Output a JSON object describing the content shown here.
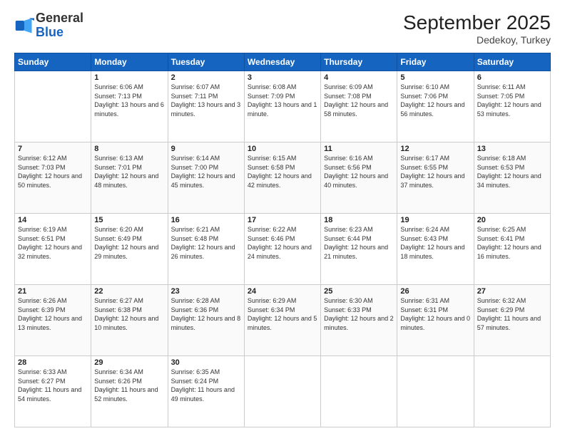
{
  "logo": {
    "general": "General",
    "blue": "Blue"
  },
  "title": "September 2025",
  "subtitle": "Dedekoy, Turkey",
  "days_header": [
    "Sunday",
    "Monday",
    "Tuesday",
    "Wednesday",
    "Thursday",
    "Friday",
    "Saturday"
  ],
  "weeks": [
    [
      {
        "day": "",
        "sunrise": "",
        "sunset": "",
        "daylight": ""
      },
      {
        "day": "1",
        "sunrise": "Sunrise: 6:06 AM",
        "sunset": "Sunset: 7:13 PM",
        "daylight": "Daylight: 13 hours and 6 minutes."
      },
      {
        "day": "2",
        "sunrise": "Sunrise: 6:07 AM",
        "sunset": "Sunset: 7:11 PM",
        "daylight": "Daylight: 13 hours and 3 minutes."
      },
      {
        "day": "3",
        "sunrise": "Sunrise: 6:08 AM",
        "sunset": "Sunset: 7:09 PM",
        "daylight": "Daylight: 13 hours and 1 minute."
      },
      {
        "day": "4",
        "sunrise": "Sunrise: 6:09 AM",
        "sunset": "Sunset: 7:08 PM",
        "daylight": "Daylight: 12 hours and 58 minutes."
      },
      {
        "day": "5",
        "sunrise": "Sunrise: 6:10 AM",
        "sunset": "Sunset: 7:06 PM",
        "daylight": "Daylight: 12 hours and 56 minutes."
      },
      {
        "day": "6",
        "sunrise": "Sunrise: 6:11 AM",
        "sunset": "Sunset: 7:05 PM",
        "daylight": "Daylight: 12 hours and 53 minutes."
      }
    ],
    [
      {
        "day": "7",
        "sunrise": "Sunrise: 6:12 AM",
        "sunset": "Sunset: 7:03 PM",
        "daylight": "Daylight: 12 hours and 50 minutes."
      },
      {
        "day": "8",
        "sunrise": "Sunrise: 6:13 AM",
        "sunset": "Sunset: 7:01 PM",
        "daylight": "Daylight: 12 hours and 48 minutes."
      },
      {
        "day": "9",
        "sunrise": "Sunrise: 6:14 AM",
        "sunset": "Sunset: 7:00 PM",
        "daylight": "Daylight: 12 hours and 45 minutes."
      },
      {
        "day": "10",
        "sunrise": "Sunrise: 6:15 AM",
        "sunset": "Sunset: 6:58 PM",
        "daylight": "Daylight: 12 hours and 42 minutes."
      },
      {
        "day": "11",
        "sunrise": "Sunrise: 6:16 AM",
        "sunset": "Sunset: 6:56 PM",
        "daylight": "Daylight: 12 hours and 40 minutes."
      },
      {
        "day": "12",
        "sunrise": "Sunrise: 6:17 AM",
        "sunset": "Sunset: 6:55 PM",
        "daylight": "Daylight: 12 hours and 37 minutes."
      },
      {
        "day": "13",
        "sunrise": "Sunrise: 6:18 AM",
        "sunset": "Sunset: 6:53 PM",
        "daylight": "Daylight: 12 hours and 34 minutes."
      }
    ],
    [
      {
        "day": "14",
        "sunrise": "Sunrise: 6:19 AM",
        "sunset": "Sunset: 6:51 PM",
        "daylight": "Daylight: 12 hours and 32 minutes."
      },
      {
        "day": "15",
        "sunrise": "Sunrise: 6:20 AM",
        "sunset": "Sunset: 6:49 PM",
        "daylight": "Daylight: 12 hours and 29 minutes."
      },
      {
        "day": "16",
        "sunrise": "Sunrise: 6:21 AM",
        "sunset": "Sunset: 6:48 PM",
        "daylight": "Daylight: 12 hours and 26 minutes."
      },
      {
        "day": "17",
        "sunrise": "Sunrise: 6:22 AM",
        "sunset": "Sunset: 6:46 PM",
        "daylight": "Daylight: 12 hours and 24 minutes."
      },
      {
        "day": "18",
        "sunrise": "Sunrise: 6:23 AM",
        "sunset": "Sunset: 6:44 PM",
        "daylight": "Daylight: 12 hours and 21 minutes."
      },
      {
        "day": "19",
        "sunrise": "Sunrise: 6:24 AM",
        "sunset": "Sunset: 6:43 PM",
        "daylight": "Daylight: 12 hours and 18 minutes."
      },
      {
        "day": "20",
        "sunrise": "Sunrise: 6:25 AM",
        "sunset": "Sunset: 6:41 PM",
        "daylight": "Daylight: 12 hours and 16 minutes."
      }
    ],
    [
      {
        "day": "21",
        "sunrise": "Sunrise: 6:26 AM",
        "sunset": "Sunset: 6:39 PM",
        "daylight": "Daylight: 12 hours and 13 minutes."
      },
      {
        "day": "22",
        "sunrise": "Sunrise: 6:27 AM",
        "sunset": "Sunset: 6:38 PM",
        "daylight": "Daylight: 12 hours and 10 minutes."
      },
      {
        "day": "23",
        "sunrise": "Sunrise: 6:28 AM",
        "sunset": "Sunset: 6:36 PM",
        "daylight": "Daylight: 12 hours and 8 minutes."
      },
      {
        "day": "24",
        "sunrise": "Sunrise: 6:29 AM",
        "sunset": "Sunset: 6:34 PM",
        "daylight": "Daylight: 12 hours and 5 minutes."
      },
      {
        "day": "25",
        "sunrise": "Sunrise: 6:30 AM",
        "sunset": "Sunset: 6:33 PM",
        "daylight": "Daylight: 12 hours and 2 minutes."
      },
      {
        "day": "26",
        "sunrise": "Sunrise: 6:31 AM",
        "sunset": "Sunset: 6:31 PM",
        "daylight": "Daylight: 12 hours and 0 minutes."
      },
      {
        "day": "27",
        "sunrise": "Sunrise: 6:32 AM",
        "sunset": "Sunset: 6:29 PM",
        "daylight": "Daylight: 11 hours and 57 minutes."
      }
    ],
    [
      {
        "day": "28",
        "sunrise": "Sunrise: 6:33 AM",
        "sunset": "Sunset: 6:27 PM",
        "daylight": "Daylight: 11 hours and 54 minutes."
      },
      {
        "day": "29",
        "sunrise": "Sunrise: 6:34 AM",
        "sunset": "Sunset: 6:26 PM",
        "daylight": "Daylight: 11 hours and 52 minutes."
      },
      {
        "day": "30",
        "sunrise": "Sunrise: 6:35 AM",
        "sunset": "Sunset: 6:24 PM",
        "daylight": "Daylight: 11 hours and 49 minutes."
      },
      {
        "day": "",
        "sunrise": "",
        "sunset": "",
        "daylight": ""
      },
      {
        "day": "",
        "sunrise": "",
        "sunset": "",
        "daylight": ""
      },
      {
        "day": "",
        "sunrise": "",
        "sunset": "",
        "daylight": ""
      },
      {
        "day": "",
        "sunrise": "",
        "sunset": "",
        "daylight": ""
      }
    ]
  ]
}
